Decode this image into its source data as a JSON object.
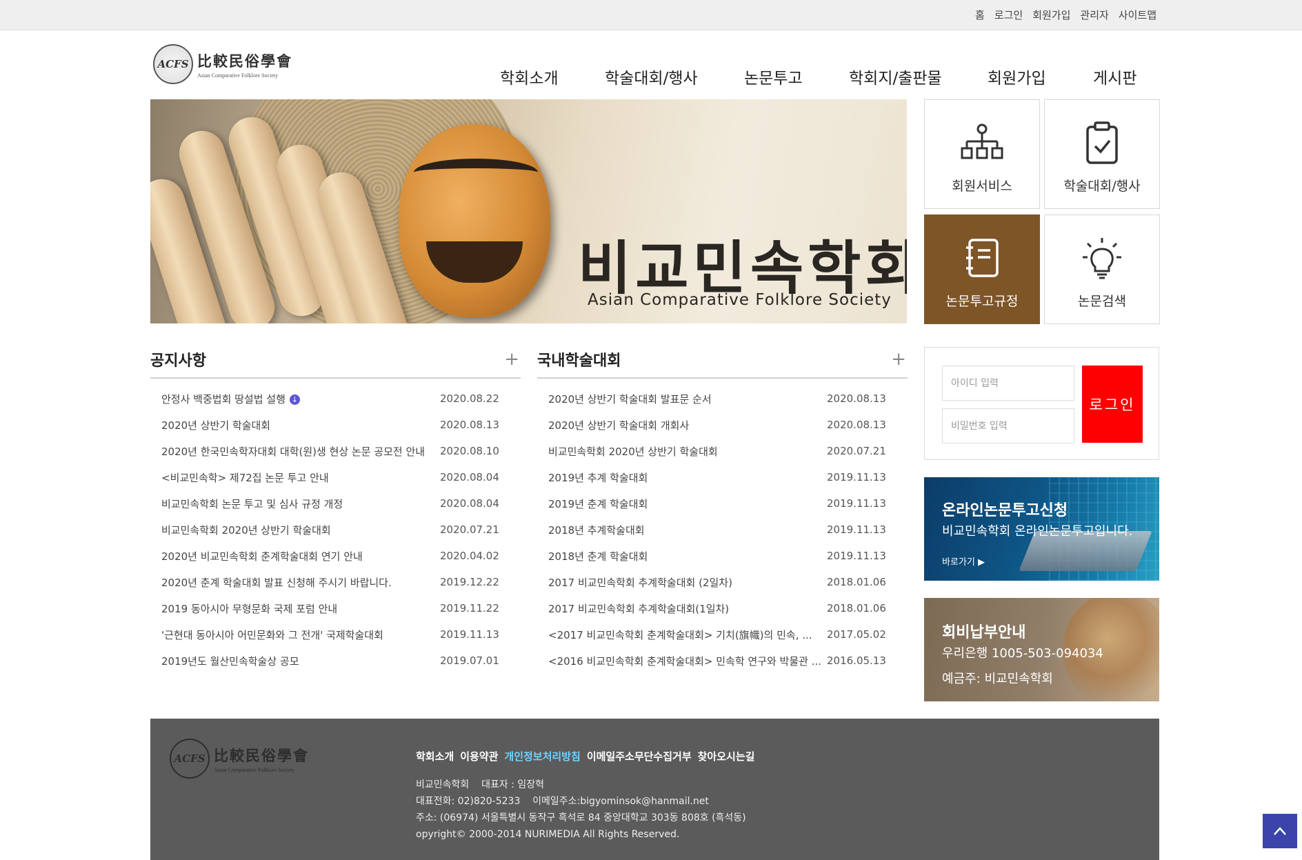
{
  "util_nav": [
    "홈",
    "로그인",
    "회원가입",
    "관리자",
    "사이트맵"
  ],
  "logo": {
    "seal_text": "ACFS",
    "hanja": "比較民俗學會",
    "english": "Asian Comparative Folklore Society"
  },
  "gnb": [
    "학회소개",
    "학술대회/행사",
    "논문투고",
    "학회지/출판물",
    "회원가입",
    "게시판"
  ],
  "banner": {
    "title_ko": "비교민속학회",
    "title_en": "Asian Comparative Folklore Society"
  },
  "quick_menu": [
    {
      "label": "회원서비스",
      "icon": "org-chart-icon"
    },
    {
      "label": "학술대회/행사",
      "icon": "clipboard-check-icon"
    },
    {
      "label": "논문투고규정",
      "icon": "notebook-icon",
      "active": true
    },
    {
      "label": "논문검색",
      "icon": "lightbulb-icon"
    }
  ],
  "notice": {
    "title": "공지사항",
    "more": "+",
    "items": [
      {
        "title": "안정사 백중법회 땅설법 설행",
        "date": "2020.08.22",
        "download": true
      },
      {
        "title": "2020년 상반기 학술대회",
        "date": "2020.08.13"
      },
      {
        "title": "2020년 한국민속학자대회 대학(원)생 현상 논문 공모전 안내",
        "date": "2020.08.10"
      },
      {
        "title": "<비교민속학> 제72집 논문 투고 안내",
        "date": "2020.08.04"
      },
      {
        "title": "비교민속학회 논문 투고 및 심사 규정 개정",
        "date": "2020.08.04"
      },
      {
        "title": "비교민속학회 2020년 상반기 학술대회",
        "date": "2020.07.21"
      },
      {
        "title": "2020년 비교민속학회 춘계학술대회 연기 안내",
        "date": "2020.04.02"
      },
      {
        "title": "2020년 춘계 학술대회 발표 신청해 주시기 바랍니다.",
        "date": "2019.12.22"
      },
      {
        "title": "2019 동아시아 무형문화 국제 포럼 안내",
        "date": "2019.11.22"
      },
      {
        "title": "'근현대 동아시아 어민문화와 그 전개' 국제학술대회",
        "date": "2019.11.13"
      },
      {
        "title": "2019년도 월산민속학술상 공모",
        "date": "2019.07.01"
      }
    ]
  },
  "conference": {
    "title": "국내학술대회",
    "more": "+",
    "items": [
      {
        "title": "2020년 상반기 학술대회 발표문 순서",
        "date": "2020.08.13"
      },
      {
        "title": "2020년 상반기 학술대회 개회사",
        "date": "2020.08.13"
      },
      {
        "title": "비교민속학회 2020년 상반기 학술대회",
        "date": "2020.07.21"
      },
      {
        "title": "2019년 추계 학술대회",
        "date": "2019.11.13"
      },
      {
        "title": "2019년 춘계 학술대회",
        "date": "2019.11.13"
      },
      {
        "title": "2018년 추계학술대회",
        "date": "2019.11.13"
      },
      {
        "title": "2018년 춘계 학술대회",
        "date": "2019.11.13"
      },
      {
        "title": "2017 비교민속학회 추계학술대회 (2일차)",
        "date": "2018.01.06"
      },
      {
        "title": "2017 비교민속학회 추계학술대회(1일차)",
        "date": "2018.01.06"
      },
      {
        "title": "<2017 비교민속학회 춘계학술대회> 기치(旗幟)의 민속, ...",
        "date": "2017.05.02"
      },
      {
        "title": "<2016 비교민속학회 춘계학술대회> 민속학 연구와 박물관 ...",
        "date": "2016.05.13"
      }
    ]
  },
  "login": {
    "id_placeholder": "아이디 입력",
    "pw_placeholder": "비밀번호 입력",
    "button": "로그인"
  },
  "promo_online": {
    "title": "온라인논문투고신청",
    "sub": "비교민속학회 온라인논문투고입니다.",
    "go": "바로가기 ▶"
  },
  "promo_fee": {
    "title": "회비납부안내",
    "account": "우리은행 1005-503-094034",
    "holder": "예금주: 비교민속학회"
  },
  "footer": {
    "links": [
      "학회소개",
      "이용약관",
      "개인정보처리방침",
      "이메일주소무단수집거부",
      "찾아오시는길"
    ],
    "highlight_index": 2,
    "info": [
      "비교민속학회    대표자 : 임장혁",
      "대표전화: 02)820-5233    이메일주소:bigyominsok@hanmail.net",
      "주소: (06974) 서울특별시 동작구 흑석로 84 중앙대학교 303동 808호 (흑석동)",
      "opyright© 2000-2014 NURIMEDIA All Rights Reserved."
    ]
  },
  "colors": {
    "active_quick": "#7e5527",
    "login_button": "#ff0000",
    "footer_bg": "#5b5b5b",
    "footer_highlight": "#6fd3ff",
    "top_button": "#3b44a8"
  }
}
